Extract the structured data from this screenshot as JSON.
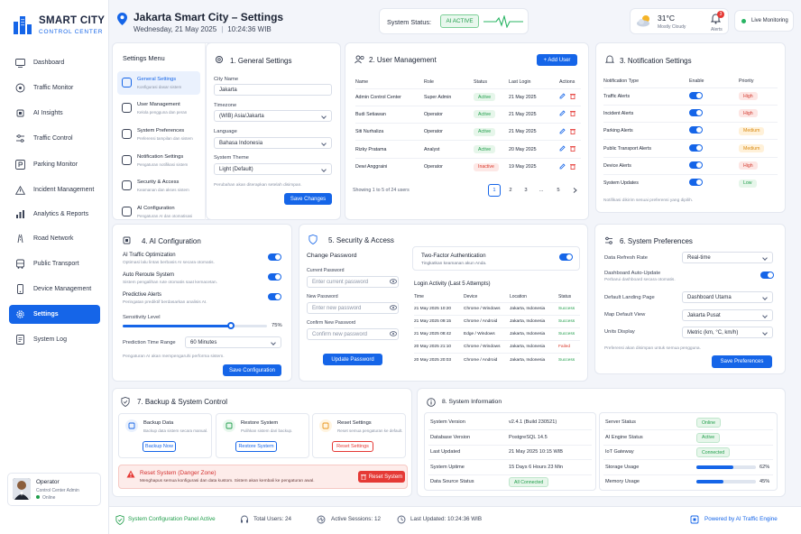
{
  "brand": {
    "name": "SMART CITY",
    "tagline": "CONTROL CENTER"
  },
  "nav": [
    {
      "label": "Dashboard",
      "icon": "monitor-icon"
    },
    {
      "label": "Traffic Monitor",
      "icon": "traffic-icon"
    },
    {
      "label": "AI Insights",
      "icon": "ai-chip-icon"
    },
    {
      "label": "Traffic Control",
      "icon": "sliders-icon"
    },
    {
      "label": "Parking Monitor",
      "icon": "parking-icon"
    },
    {
      "label": "Incident Management",
      "icon": "warning-icon"
    },
    {
      "label": "Analytics & Reports",
      "icon": "chart-icon"
    },
    {
      "label": "Road Network",
      "icon": "road-icon"
    },
    {
      "label": "Public Transport",
      "icon": "bus-icon"
    },
    {
      "label": "Device Management",
      "icon": "device-icon"
    },
    {
      "label": "Settings",
      "icon": "gear-icon"
    },
    {
      "label": "System Log",
      "icon": "log-icon"
    }
  ],
  "profile": {
    "role": "Operator",
    "title": "Control Center Admin",
    "status": "Online"
  },
  "header": {
    "title": "Jakarta Smart City – Settings",
    "date": "Wednesday, 21 May 2025",
    "time": "10:24:36 WIB",
    "status_label": "System Status:",
    "status_value": "AI ACTIVE",
    "weather_temp": "31°C",
    "weather_desc": "Mostly Cloudy",
    "alerts_label": "Alerts",
    "alerts_count": "3",
    "live_label": "Live Monitoring"
  },
  "settings_menu": {
    "title": "Settings Menu",
    "items": [
      {
        "title": "General Settings",
        "desc": "Konfigurasi dasar sistem"
      },
      {
        "title": "User Management",
        "desc": "Kelola pengguna dan peran"
      },
      {
        "title": "System Preferences",
        "desc": "Preferensi tampilan dan sistem"
      },
      {
        "title": "Notification Settings",
        "desc": "Pengaturan notifikasi sistem"
      },
      {
        "title": "Security & Access",
        "desc": "Keamanan dan akses sistem"
      },
      {
        "title": "AI Configuration",
        "desc": "Pengaturan AI dan otomatisasi"
      }
    ]
  },
  "general": {
    "title": "1. General Settings",
    "city_label": "City Name",
    "city": "Jakarta",
    "tz_label": "Timezone",
    "tz": "(WIB) Asia/Jakarta",
    "lang_label": "Language",
    "lang": "Bahasa Indonesia",
    "theme_label": "System Theme",
    "theme": "Light (Default)",
    "note": "Perubahan akan diterapkan setelah disimpan.",
    "save": "Save Changes"
  },
  "users": {
    "title": "2. User Management",
    "add": "+ Add User",
    "headers": [
      "Name",
      "Role",
      "Status",
      "Last Login",
      "Actions"
    ],
    "rows": [
      {
        "name": "Admin Control Center",
        "role": "Super Admin",
        "status": "Active",
        "login": "21 May 2025"
      },
      {
        "name": "Budi Setiawan",
        "role": "Operator",
        "status": "Active",
        "login": "21 May 2025"
      },
      {
        "name": "Siti Nurhaliza",
        "role": "Operator",
        "status": "Active",
        "login": "21 May 2025"
      },
      {
        "name": "Rizky Pratama",
        "role": "Analyst",
        "status": "Active",
        "login": "20 May 2025"
      },
      {
        "name": "Dewi Anggraini",
        "role": "Operator",
        "status": "Inactive",
        "login": "19 May 2025"
      }
    ],
    "showing": "Showing 1 to 5 of 24 users",
    "pages": [
      "1",
      "2",
      "3",
      "...",
      "5"
    ]
  },
  "notif": {
    "title": "3. Notification Settings",
    "headers": [
      "Notification Type",
      "Enable",
      "Priority"
    ],
    "rows": [
      {
        "type": "Traffic Alerts",
        "priority": "High",
        "cls": "hi"
      },
      {
        "type": "Incident Alerts",
        "priority": "High",
        "cls": "hi"
      },
      {
        "type": "Parking Alerts",
        "priority": "Medium",
        "cls": "med"
      },
      {
        "type": "Public Transport Alerts",
        "priority": "Medium",
        "cls": "med"
      },
      {
        "type": "Device Alerts",
        "priority": "High",
        "cls": "hi"
      },
      {
        "type": "System Updates",
        "priority": "Low",
        "cls": "low"
      }
    ],
    "note": "Notifikasi dikirim sesuai preferensi yang dipilih."
  },
  "ai": {
    "title": "4. AI Configuration",
    "items": [
      {
        "title": "AI Traffic Optimization",
        "desc": "Optimasi lalu lintas berbasis AI secara otomatis."
      },
      {
        "title": "Auto Reroute System",
        "desc": "Sistem pengalihan rute otomatis saat kemacetan."
      },
      {
        "title": "Predictive Alerts",
        "desc": "Peringatan prediktif berdasarkan analisis AI."
      }
    ],
    "sens_label": "Sensitivity Level",
    "sens_value": "75%",
    "sens_fraction": 0.75,
    "range_label": "Prediction Time Range",
    "range": "60 Minutes",
    "note": "Pengaturan AI akan mempengaruhi performa sistem.",
    "save": "Save Configuration"
  },
  "security": {
    "title": "5. Security & Access",
    "cp_title": "Change Password",
    "cur_label": "Current Password",
    "cur_ph": "Enter current password",
    "new_label": "New Password",
    "new_ph": "Enter new password",
    "conf_label": "Confirm New Password",
    "conf_ph": "Confirm new password",
    "update": "Update Password",
    "tfa_title": "Two-Factor Authentication",
    "tfa_desc": "Tingkatkan keamanan akun Anda.",
    "log_title": "Login Activity (Last 5 Attempts)",
    "log_headers": [
      "Time",
      "Device",
      "Location",
      "Status"
    ],
    "log_rows": [
      {
        "time": "21 May 2025 10:20",
        "device": "Chrome / Windows",
        "loc": "Jakarta, Indonesia",
        "status": "Success",
        "cls": "succ"
      },
      {
        "time": "21 May 2025 09:15",
        "device": "Chrome / Android",
        "loc": "Jakarta, Indonesia",
        "status": "Success",
        "cls": "succ"
      },
      {
        "time": "21 May 2025 08:42",
        "device": "Edge / Windows",
        "loc": "Jakarta, Indonesia",
        "status": "Success",
        "cls": "succ"
      },
      {
        "time": "20 May 2025 21:10",
        "device": "Chrome / Windows",
        "loc": "Jakarta, Indonesia",
        "status": "Failed",
        "cls": "fail"
      },
      {
        "time": "20 May 2025 20:03",
        "device": "Chrome / Android",
        "loc": "Jakarta, Indonesia",
        "status": "Success",
        "cls": "succ"
      }
    ]
  },
  "prefs": {
    "title": "6. System Preferences",
    "refresh_label": "Data Refresh Rate",
    "refresh": "Real-time",
    "auto_label": "Dashboard Auto-Update",
    "auto_desc": "Perbarui dashboard secara otomatis.",
    "landing_label": "Default Landing Page",
    "landing": "Dashboard Utama",
    "map_label": "Map Default View",
    "map": "Jakarta Pusat",
    "units_label": "Units Display",
    "units": "Metric (km, °C, km/h)",
    "note": "Preferensi akan disimpan untuk semua pengguna.",
    "save": "Save Preferences"
  },
  "backup": {
    "title": "7. Backup & System Control",
    "items": [
      {
        "title": "Backup Data",
        "desc": "Backup data sistem secara manual.",
        "btn": "Backup Now"
      },
      {
        "title": "Restore System",
        "desc": "Pulihkan sistem dari backup.",
        "btn": "Restore System"
      },
      {
        "title": "Reset Settings",
        "desc": "Reset semua pengaturan ke default.",
        "btn": "Reset Settings"
      }
    ],
    "danger_title": "Reset System (Danger Zone)",
    "danger_desc": "Menghapus semua konfigurasi dan data kustom. Sistem akan kembali ke pengaturan awal.",
    "danger_btn": "Reset System"
  },
  "sysinfo": {
    "title": "8. System Information",
    "left": [
      {
        "k": "System Version",
        "v": "v2.4.1 (Build 230521)"
      },
      {
        "k": "Database Version",
        "v": "PostgreSQL 14.5"
      },
      {
        "k": "Last Updated",
        "v": "21 May 2025 10:15 WIB"
      },
      {
        "k": "System Uptime",
        "v": "15 Days 6 Hours 23 Min"
      },
      {
        "k": "Data Source Status",
        "v": "All Connected"
      }
    ],
    "right": [
      {
        "k": "Server Status",
        "v": "Online"
      },
      {
        "k": "AI Engine Status",
        "v": "Active"
      },
      {
        "k": "IoT Gateway",
        "v": "Connected"
      },
      {
        "k": "Storage Usage",
        "v": "62%",
        "f": 0.62
      },
      {
        "k": "Memory Usage",
        "v": "45%",
        "f": 0.45
      }
    ]
  },
  "footer": {
    "status": "System Configuration Panel Active",
    "users": "Total Users: 24",
    "sessions": "Active Sessions: 12",
    "updated": "Last Updated: 10:24:36 WIB",
    "powered": "Powered by AI Traffic Engine"
  },
  "colors": {
    "accent": "#1565e8",
    "success": "#1f9d4a",
    "danger": "#e53935"
  }
}
